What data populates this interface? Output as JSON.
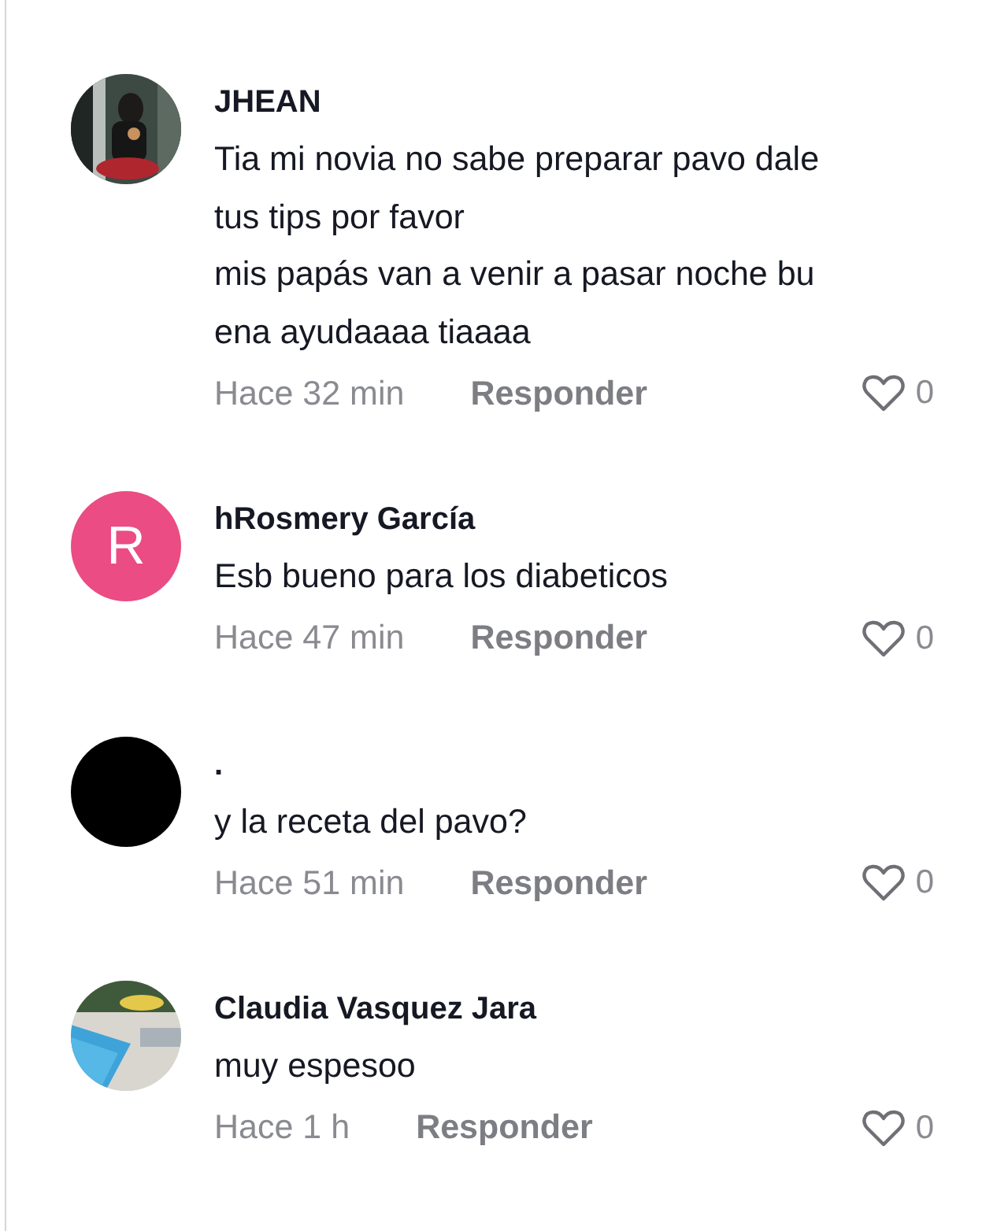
{
  "comments": [
    {
      "author": "JHEAN",
      "lines": [
        "Tia mi novia no sabe preparar pavo dale",
        "tus tips por favor",
        "mis papás van a venir a pasar noche bu",
        "ena ayudaaaa tiaaaa"
      ],
      "time": "Hace 32 min",
      "reply": "Responder",
      "likes": "0"
    },
    {
      "author": "hRosmery García",
      "avatar": {
        "kind": "letter",
        "letter": "R",
        "color": "#ea4c83"
      },
      "lines": [
        "Esb bueno para los diabeticos"
      ],
      "time": "Hace 47 min",
      "reply": "Responder",
      "likes": "0"
    },
    {
      "author": ".",
      "avatar": {
        "kind": "plain",
        "color": "#000000"
      },
      "lines": [
        "y la receta del pavo?"
      ],
      "time": "Hace 51 min",
      "reply": "Responder",
      "likes": "0"
    },
    {
      "author": "Claudia Vasquez Jara",
      "lines": [
        "muy espesoo"
      ],
      "time": "Hace 1 h",
      "reply": "Responder",
      "likes": "0"
    }
  ]
}
